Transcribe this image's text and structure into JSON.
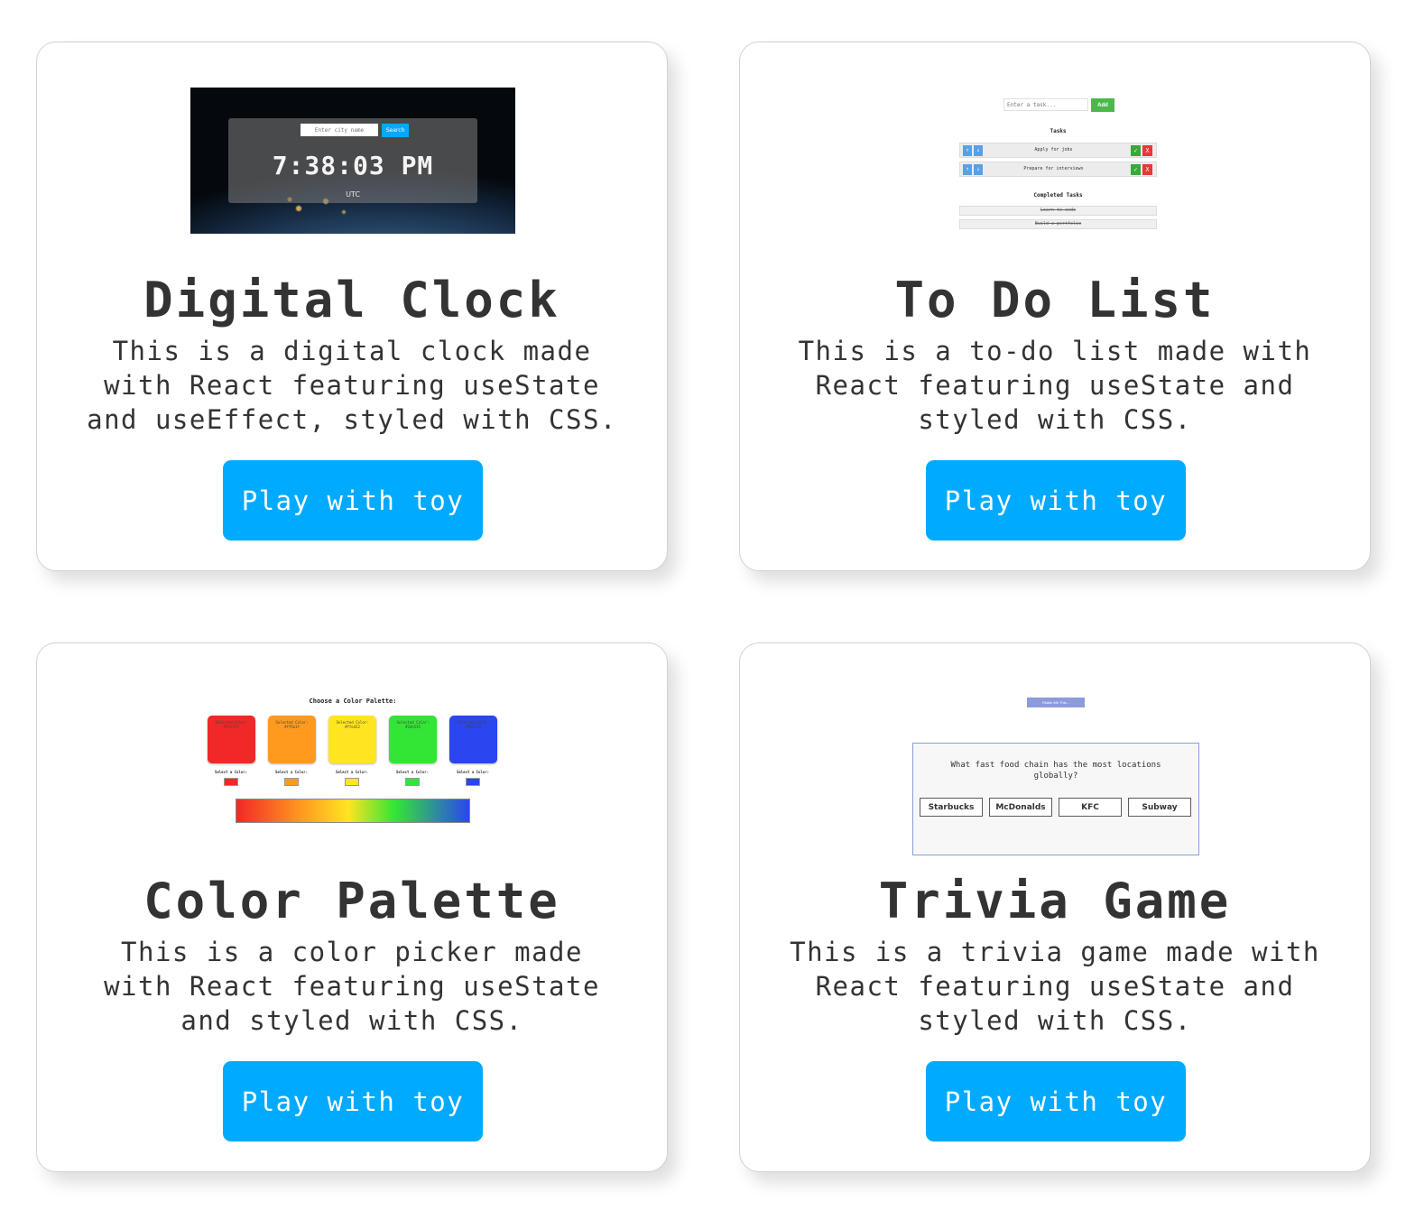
{
  "cards": {
    "clock": {
      "title": "Digital Clock",
      "description": "This is a digital clock made with React featuring useState and useEffect, styled with CSS.",
      "button_label": "Play with toy",
      "preview": {
        "city_placeholder": "Enter city name",
        "search_label": "Search",
        "time": "7:38:03 PM",
        "timezone": "UTC"
      }
    },
    "todo": {
      "title": "To Do List",
      "description": "This is a to-do list made with React featuring useState and styled with CSS.",
      "button_label": "Play with toy",
      "preview": {
        "task_placeholder": "Enter a task...",
        "add_label": "Add",
        "tasks_heading": "Tasks",
        "tasks": [
          "Apply for jobs",
          "Prepare for interviews"
        ],
        "up_symbol": "↑",
        "down_symbol": "↓",
        "check_symbol": "✓",
        "delete_symbol": "X",
        "completed_heading": "Completed Tasks",
        "completed": [
          "Learn to code",
          "Build a portfolio"
        ]
      }
    },
    "palette": {
      "title": "Color Palette",
      "description": "This is a color picker made with React featuring useState and styled with CSS.",
      "button_label": "Play with toy",
      "preview": {
        "heading": "Choose a Color Palette:",
        "select_label": "Select a Color:",
        "swatches": [
          {
            "label": "Selected Color: #f22727",
            "color": "#f22727"
          },
          {
            "label": "Selected Color: #ff9a1f",
            "color": "#ff9a1f"
          },
          {
            "label": "Selected Color: #ffe422",
            "color": "#ffe422"
          },
          {
            "label": "Selected Color: #33e535",
            "color": "#33e535"
          },
          {
            "label": "Selected Color: #2b45f0",
            "color": "#2b45f0"
          }
        ]
      }
    },
    "trivia": {
      "title": "Trivia Game",
      "description": "This is a trivia game made with React featuring useState and styled with CSS.",
      "button_label": "Play with toy",
      "preview": {
        "riddle_label": "Riddle Me This...",
        "question": "What fast food chain has the most locations globally?",
        "answers": [
          "Starbucks",
          "McDonalds",
          "KFC",
          "Subway"
        ]
      }
    }
  },
  "colors": {
    "accent": "#00aaff",
    "text": "#333333",
    "card_border": "#d2d2d2"
  }
}
